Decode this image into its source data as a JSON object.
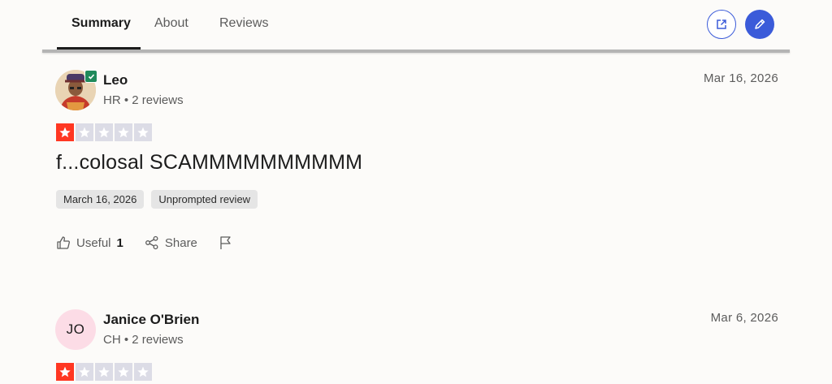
{
  "tabs": [
    {
      "label": "Summary",
      "active": true
    },
    {
      "label": "About",
      "active": false
    },
    {
      "label": "Reviews",
      "active": false
    }
  ],
  "header_buttons": [
    {
      "icon": "external-link-icon",
      "style": "outline"
    },
    {
      "icon": "pencil-icon",
      "style": "filled"
    }
  ],
  "colors": {
    "accent": "#3b5bd9",
    "star_filled": "#ff3722",
    "star_empty": "#dcdce6",
    "verified": "#1f8a5b"
  },
  "reviews": [
    {
      "name": "Leo",
      "verified": true,
      "meta": "HR • 2 reviews",
      "date": "Mar 16, 2026",
      "rating": 1,
      "title": "f...colosal SCAMMMMMMMMMM",
      "chips": [
        "March 16, 2026",
        "Unprompted review"
      ],
      "useful_label": "Useful",
      "useful_count": "1",
      "share_label": "Share"
    },
    {
      "name": "Janice O'Brien",
      "initials": "JO",
      "meta": "CH • 2 reviews",
      "date": "Mar 6, 2026",
      "rating": 1
    }
  ]
}
